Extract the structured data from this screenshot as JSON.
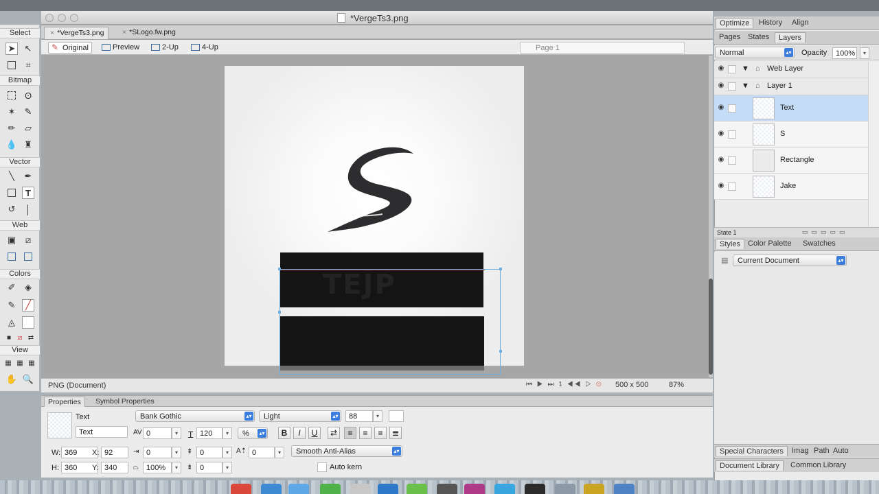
{
  "window": {
    "title": "*VergeTs3.png"
  },
  "tabs": [
    {
      "label": "*VergeTs3.png",
      "close": "×"
    },
    {
      "label": "*SLogo.fw.png",
      "close": "×"
    }
  ],
  "views": {
    "original": "Original",
    "preview": "Preview",
    "two_up": "2-Up",
    "four_up": "4-Up",
    "page": "Page 1"
  },
  "toolbox": {
    "select": "Select",
    "bitmap": "Bitmap",
    "vector": "Vector",
    "web": "Web",
    "colors": "Colors",
    "view": "View"
  },
  "status": {
    "doc_type": "PNG (Document)",
    "frame": "1",
    "canvas_size": "500 x 500",
    "zoom": "87%"
  },
  "properties": {
    "tabs": [
      "Properties",
      "Symbol Properties"
    ],
    "object_type": "Text",
    "object_name": "Text",
    "font": "Bank Gothic",
    "style": "Light",
    "size": "88",
    "kerning": "0",
    "leading": "120",
    "leading_unit": "%",
    "indent": "0",
    "space_before": "0",
    "space_after": "0",
    "baseline_shift": "0",
    "horiz_scale": "100%",
    "anti_alias": "Smooth Anti-Alias",
    "auto_kern": "Auto kern",
    "w_label": "W:",
    "w": "369",
    "h_label": "H:",
    "h": "360",
    "x_label": "X:",
    "x": "92",
    "y_label": "Y:",
    "y": "340",
    "bold": "B",
    "italic": "I",
    "underline": "U"
  },
  "right_panel": {
    "top_tabs": [
      "Optimize",
      "History",
      "Align"
    ],
    "sub_tabs": [
      "Pages",
      "States",
      "Layers"
    ],
    "blend_mode": "Normal",
    "opacity_label": "Opacity",
    "opacity": "100%",
    "layers": [
      {
        "name": "Web Layer",
        "type": "folder"
      },
      {
        "name": "Layer 1",
        "type": "folder"
      },
      {
        "name": "Text",
        "type": "object",
        "selected": true
      },
      {
        "name": "S",
        "type": "object"
      },
      {
        "name": "Rectangle",
        "type": "object"
      },
      {
        "name": "Jake",
        "type": "object"
      }
    ],
    "state": "State 1",
    "style_tabs": [
      "Styles",
      "Color Palette",
      "Swatches"
    ],
    "style_source": "Current Document",
    "bottom_tabs_1": [
      "Special Characters",
      "Imag",
      "Path",
      "Auto"
    ],
    "bottom_tabs_2": [
      "Document Library",
      "Common Library"
    ]
  },
  "canvas": {
    "ghost_text": "TEJP"
  }
}
